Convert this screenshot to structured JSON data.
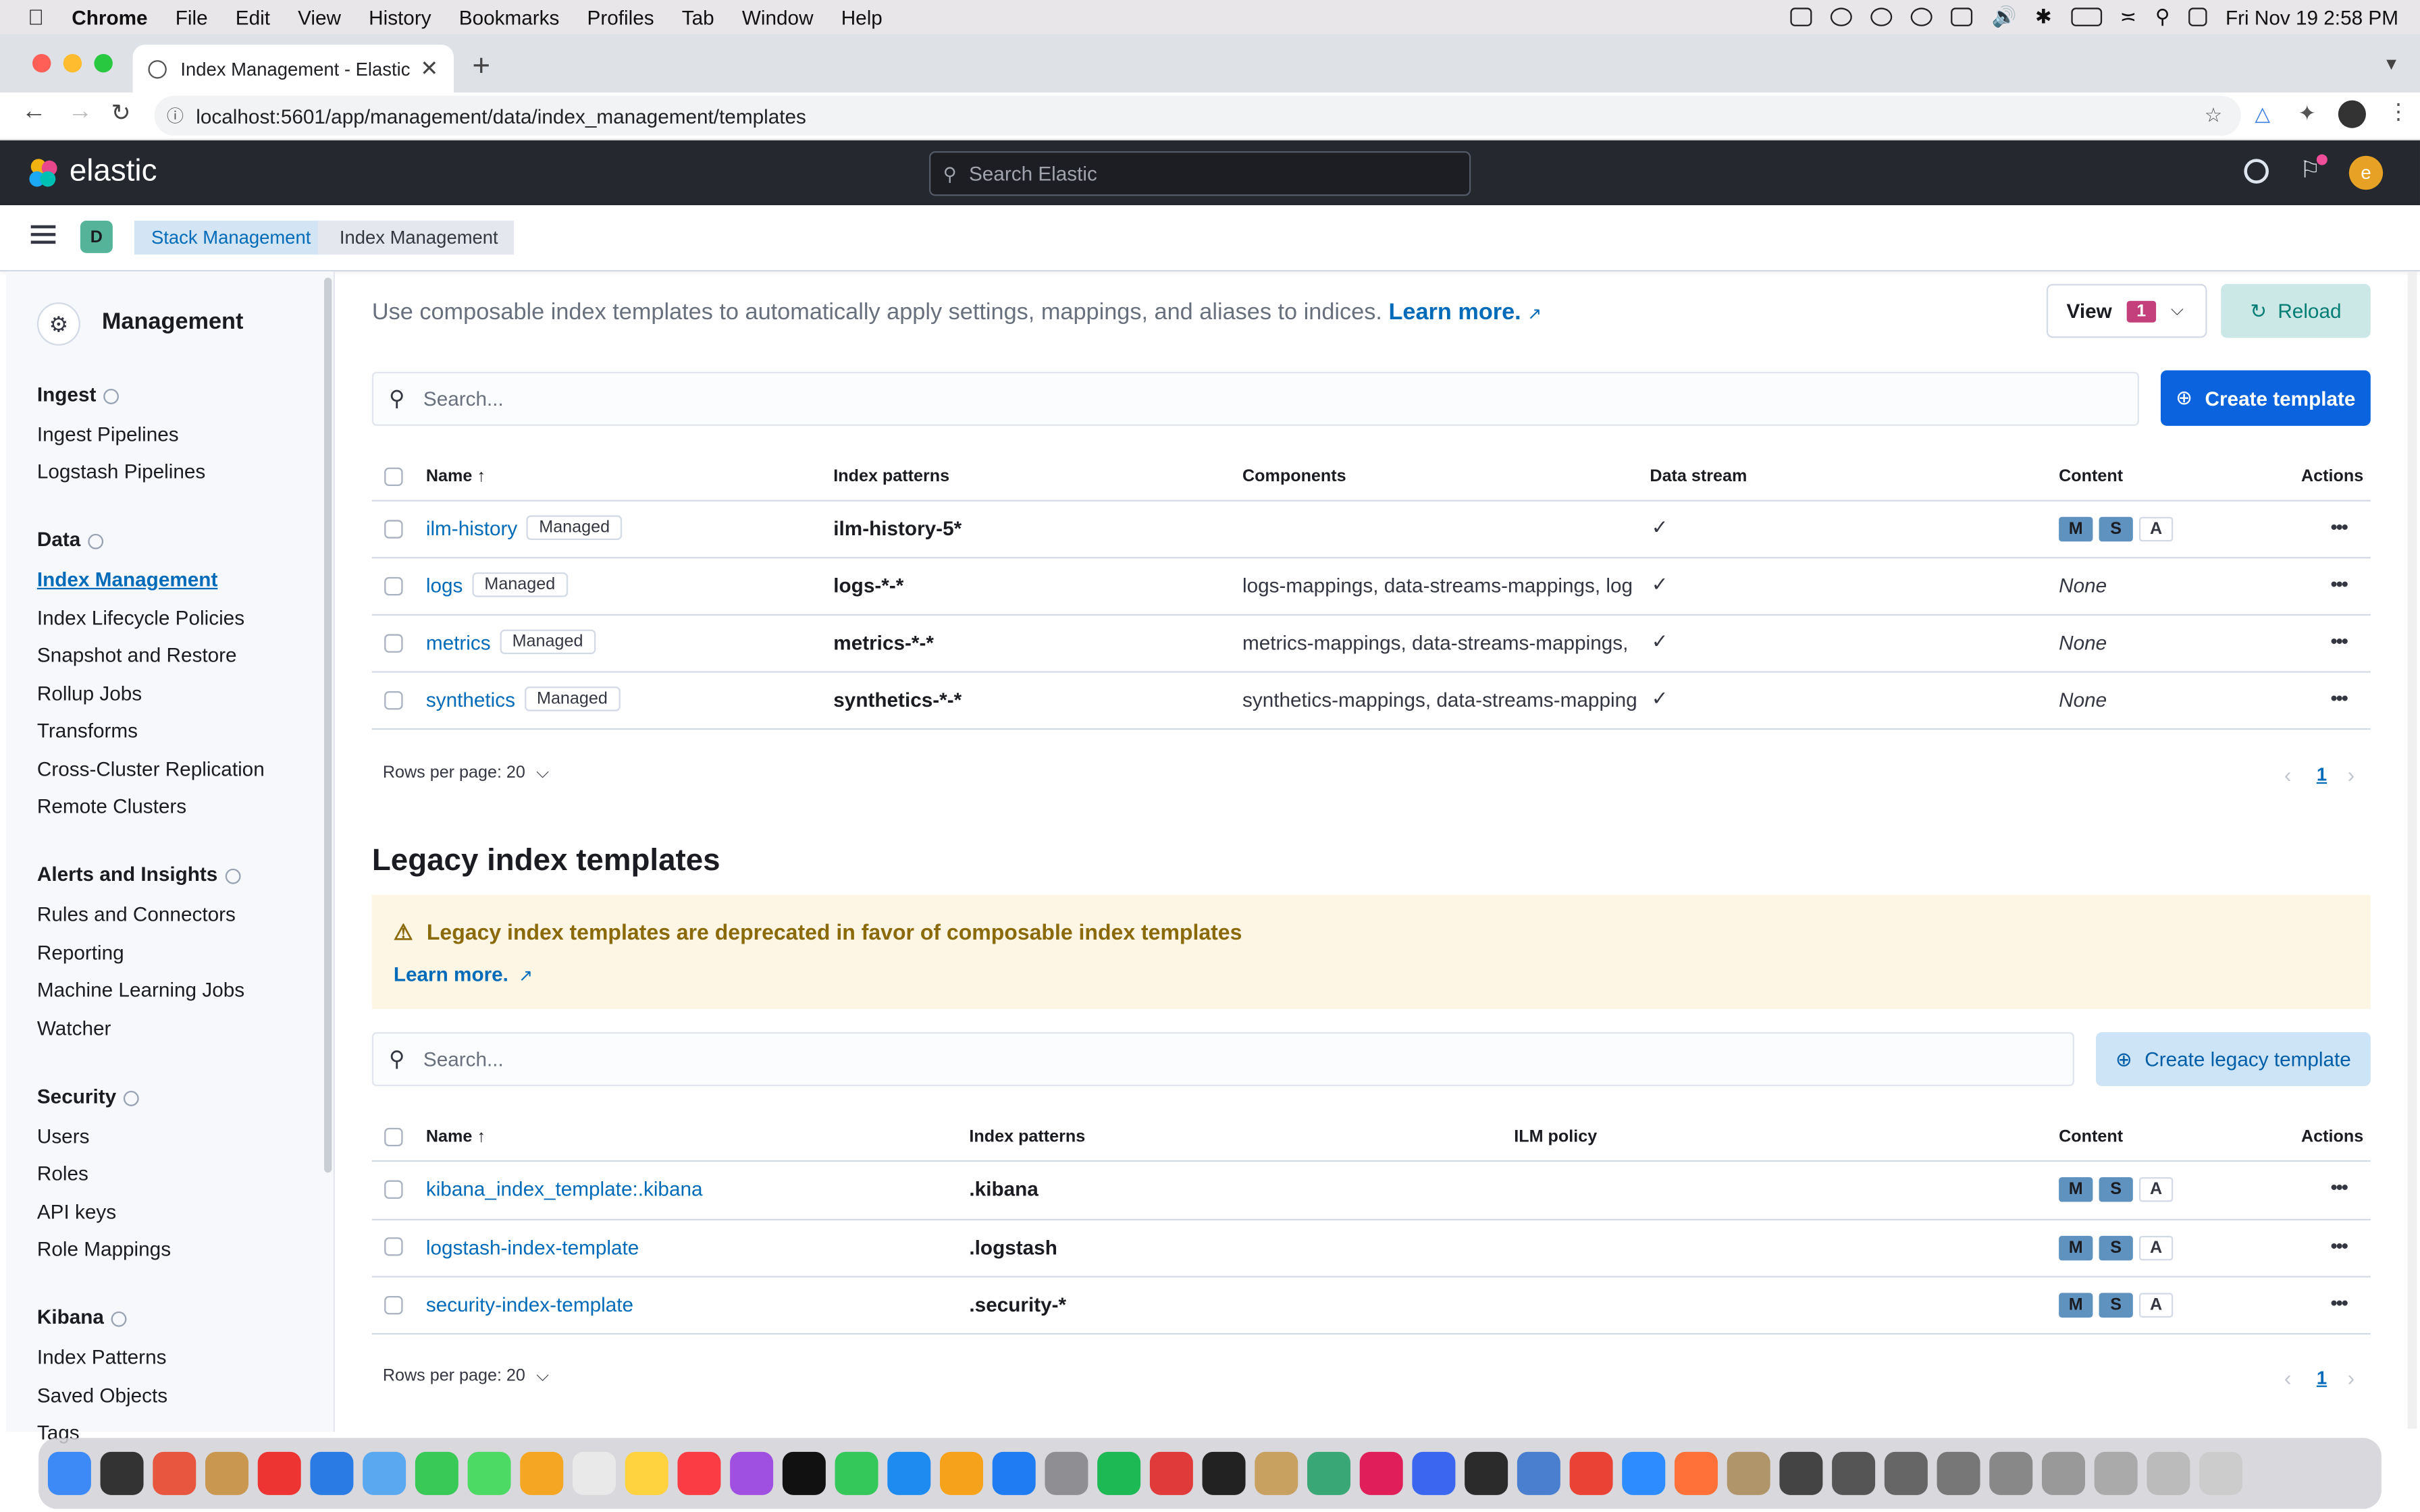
{
  "menubar": {
    "app": "Chrome",
    "items": [
      "File",
      "Edit",
      "View",
      "History",
      "Bookmarks",
      "Profiles",
      "Tab",
      "Window",
      "Help"
    ],
    "clock": "Fri Nov 19  2:58 PM"
  },
  "browser": {
    "tab_title": "Index Management - Elastic",
    "url": "localhost:5601/app/management/data/index_management/templates"
  },
  "kibana": {
    "logo": "elastic",
    "search_placeholder": "Search Elastic",
    "avatar": "e",
    "space": "D",
    "breadcrumbs": [
      "Stack Management",
      "Index Management"
    ]
  },
  "sidenav": {
    "title": "Management",
    "sections": [
      {
        "heading": "Ingest",
        "items": [
          "Ingest Pipelines",
          "Logstash Pipelines"
        ]
      },
      {
        "heading": "Data",
        "items": [
          "Index Management",
          "Index Lifecycle Policies",
          "Snapshot and Restore",
          "Rollup Jobs",
          "Transforms",
          "Cross-Cluster Replication",
          "Remote Clusters"
        ]
      },
      {
        "heading": "Alerts and Insights",
        "items": [
          "Rules and Connectors",
          "Reporting",
          "Machine Learning Jobs",
          "Watcher"
        ]
      },
      {
        "heading": "Security",
        "items": [
          "Users",
          "Roles",
          "API keys",
          "Role Mappings"
        ]
      },
      {
        "heading": "Kibana",
        "items": [
          "Index Patterns",
          "Saved Objects",
          "Tags"
        ]
      }
    ],
    "active_item": "Index Management"
  },
  "composable": {
    "description": "Use composable index templates to automatically apply settings, mappings, and aliases to indices.",
    "learn_more": "Learn more.",
    "view_label": "View",
    "view_count": "1",
    "reload_label": "Reload",
    "search_placeholder": "Search...",
    "create_label": "Create template",
    "columns": [
      "Name",
      "Index patterns",
      "Components",
      "Data stream",
      "Content",
      "Actions"
    ],
    "rows": [
      {
        "name": "ilm-history",
        "badge": "Managed",
        "patterns": "ilm-history-5*",
        "components": "",
        "data_stream": true,
        "content": "MSA"
      },
      {
        "name": "logs",
        "badge": "Managed",
        "patterns": "logs-*-*",
        "components": "logs-mappings, data-streams-mappings, log",
        "data_stream": true,
        "content": "None"
      },
      {
        "name": "metrics",
        "badge": "Managed",
        "patterns": "metrics-*-*",
        "components": "metrics-mappings, data-streams-mappings,",
        "data_stream": true,
        "content": "None"
      },
      {
        "name": "synthetics",
        "badge": "Managed",
        "patterns": "synthetics-*-*",
        "components": "synthetics-mappings, data-streams-mapping",
        "data_stream": true,
        "content": "None"
      }
    ],
    "rows_per_page": "Rows per page: 20",
    "page": "1"
  },
  "legacy": {
    "heading": "Legacy index templates",
    "callout_title": "Legacy index templates are deprecated in favor of composable index templates",
    "callout_link": "Learn more.",
    "search_placeholder": "Search...",
    "create_label": "Create legacy template",
    "columns": [
      "Name",
      "Index patterns",
      "ILM policy",
      "Content",
      "Actions"
    ],
    "rows": [
      {
        "name": "kibana_index_template:.kibana",
        "patterns": ".kibana",
        "ilm": ""
      },
      {
        "name": "logstash-index-template",
        "patterns": ".logstash",
        "ilm": ""
      },
      {
        "name": "security-index-template",
        "patterns": ".security-*",
        "ilm": ""
      }
    ],
    "rows_per_page": "Rows per page: 20",
    "page": "1"
  },
  "content_badges": [
    "M",
    "S",
    "A"
  ],
  "colors": {
    "accent": "#0b64dd",
    "link": "#006bb8",
    "header": "#25282f",
    "callout": "#fef6e5",
    "warning_text": "#8a6a0a"
  },
  "dock_count": 42
}
